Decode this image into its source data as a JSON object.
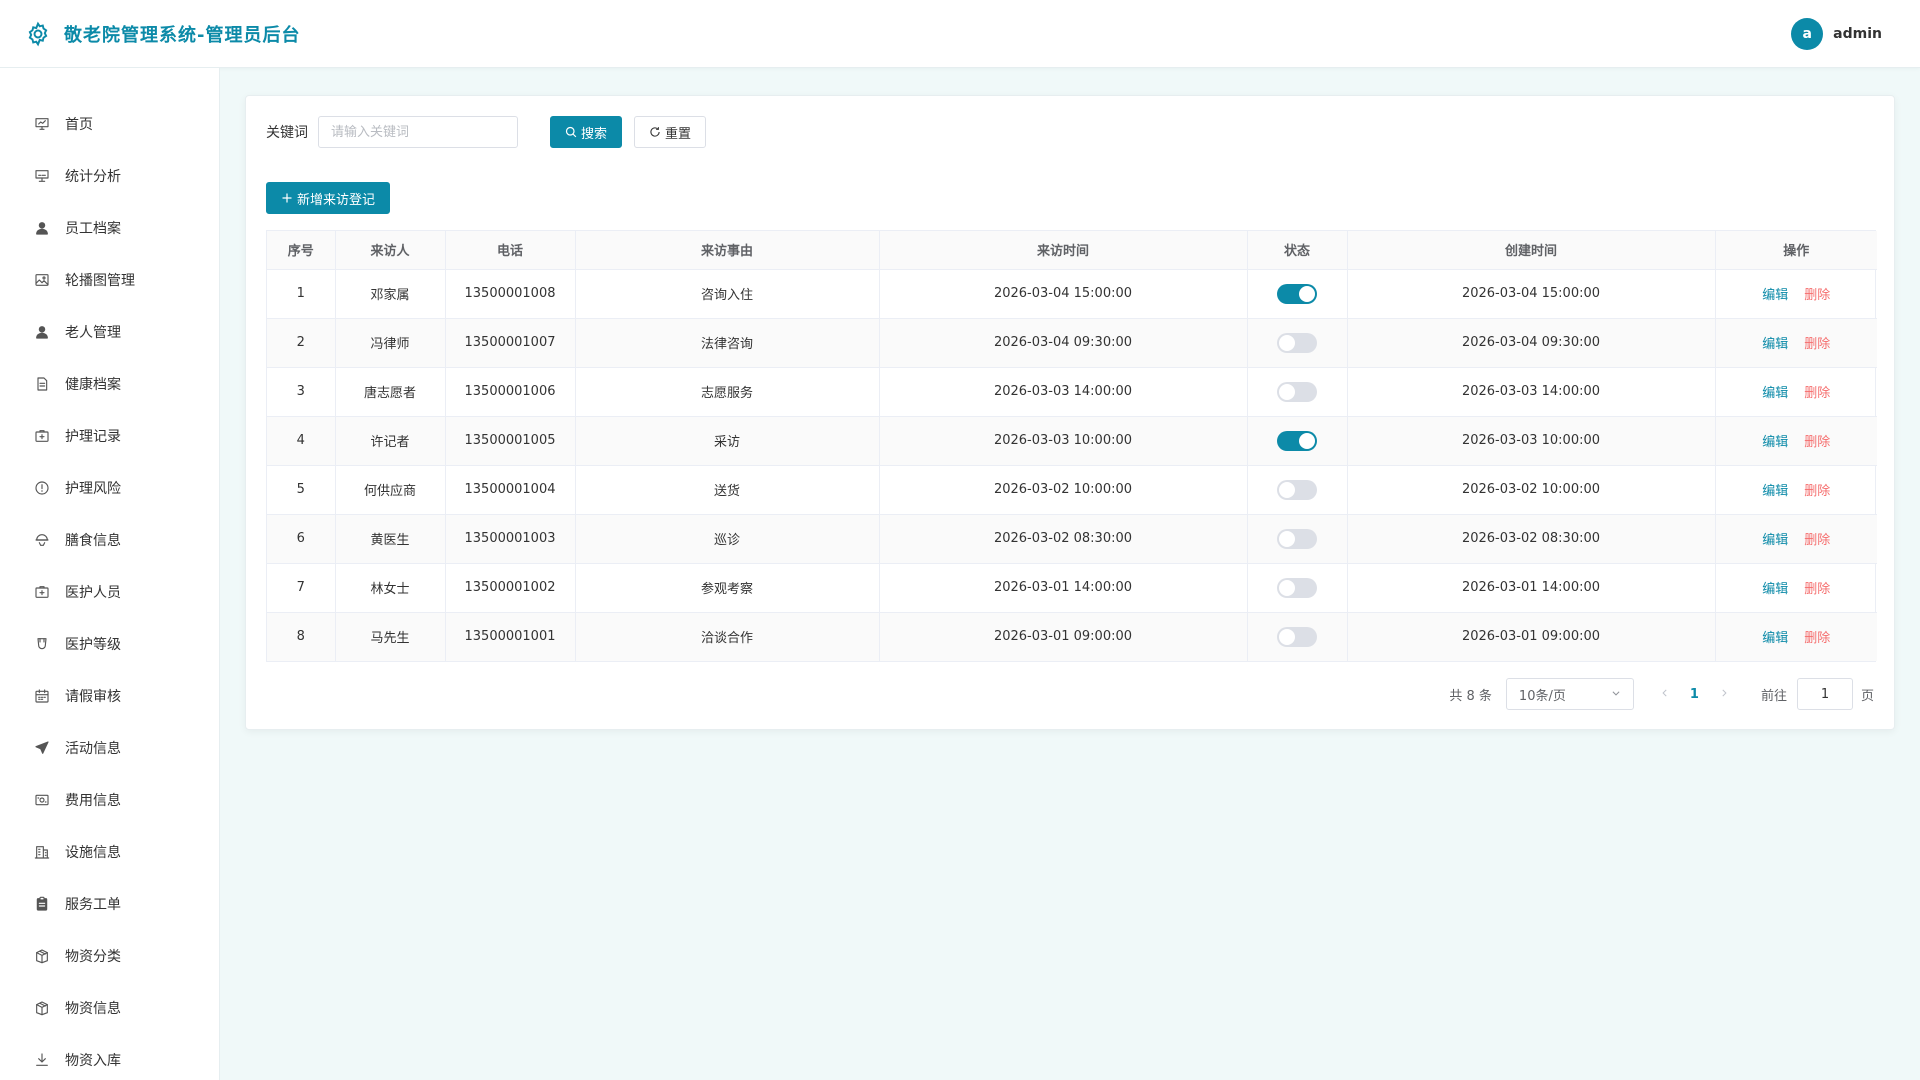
{
  "header": {
    "title": "敬老院管理系统-管理员后台",
    "avatar_letter": "a",
    "username": "admin"
  },
  "sidebar": {
    "items": [
      {
        "label": "首页",
        "icon": "dashboard-icon"
      },
      {
        "label": "统计分析",
        "icon": "presentation-icon"
      },
      {
        "label": "员工档案",
        "icon": "user-icon"
      },
      {
        "label": "轮播图管理",
        "icon": "picture-icon"
      },
      {
        "label": "老人管理",
        "icon": "user-icon"
      },
      {
        "label": "健康档案",
        "icon": "document-icon"
      },
      {
        "label": "护理记录",
        "icon": "first-aid-icon"
      },
      {
        "label": "护理风险",
        "icon": "warning-icon"
      },
      {
        "label": "膳食信息",
        "icon": "food-icon"
      },
      {
        "label": "医护人员",
        "icon": "first-aid-icon"
      },
      {
        "label": "医护等级",
        "icon": "cup-icon"
      },
      {
        "label": "请假审核",
        "icon": "calendar-icon"
      },
      {
        "label": "活动信息",
        "icon": "send-icon"
      },
      {
        "label": "费用信息",
        "icon": "money-icon"
      },
      {
        "label": "设施信息",
        "icon": "building-icon"
      },
      {
        "label": "服务工单",
        "icon": "clipboard-icon"
      },
      {
        "label": "物资分类",
        "icon": "box-icon"
      },
      {
        "label": "物资信息",
        "icon": "box-icon"
      },
      {
        "label": "物资入库",
        "icon": "download-icon"
      }
    ]
  },
  "search": {
    "label": "关键词",
    "placeholder": "请输入关键词",
    "search_btn": "搜索",
    "reset_btn": "重置"
  },
  "toolbar": {
    "add_btn": "新增来访登记"
  },
  "table": {
    "columns": [
      "序号",
      "来访人",
      "电话",
      "来访事由",
      "来访时间",
      "状态",
      "创建时间",
      "操作"
    ],
    "edit_label": "编辑",
    "delete_label": "删除",
    "rows": [
      {
        "index": "1",
        "visitor": "邓家属",
        "phone": "13500001008",
        "reason": "咨询入住",
        "visit_time": "2026-03-04 15:00:00",
        "status": true,
        "created": "2026-03-04 15:00:00"
      },
      {
        "index": "2",
        "visitor": "冯律师",
        "phone": "13500001007",
        "reason": "法律咨询",
        "visit_time": "2026-03-04 09:30:00",
        "status": false,
        "created": "2026-03-04 09:30:00"
      },
      {
        "index": "3",
        "visitor": "唐志愿者",
        "phone": "13500001006",
        "reason": "志愿服务",
        "visit_time": "2026-03-03 14:00:00",
        "status": false,
        "created": "2026-03-03 14:00:00"
      },
      {
        "index": "4",
        "visitor": "许记者",
        "phone": "13500001005",
        "reason": "采访",
        "visit_time": "2026-03-03 10:00:00",
        "status": true,
        "created": "2026-03-03 10:00:00"
      },
      {
        "index": "5",
        "visitor": "何供应商",
        "phone": "13500001004",
        "reason": "送货",
        "visit_time": "2026-03-02 10:00:00",
        "status": false,
        "created": "2026-03-02 10:00:00"
      },
      {
        "index": "6",
        "visitor": "黄医生",
        "phone": "13500001003",
        "reason": "巡诊",
        "visit_time": "2026-03-02 08:30:00",
        "status": false,
        "created": "2026-03-02 08:30:00"
      },
      {
        "index": "7",
        "visitor": "林女士",
        "phone": "13500001002",
        "reason": "参观考察",
        "visit_time": "2026-03-01 14:00:00",
        "status": false,
        "created": "2026-03-01 14:00:00"
      },
      {
        "index": "8",
        "visitor": "马先生",
        "phone": "13500001001",
        "reason": "洽谈合作",
        "visit_time": "2026-03-01 09:00:00",
        "status": false,
        "created": "2026-03-01 09:00:00"
      }
    ]
  },
  "pagination": {
    "total": "共 8 条",
    "page_size": "10条/页",
    "current": "1",
    "goto_label": "前往",
    "goto_value": "1",
    "goto_unit": "页"
  },
  "colors": {
    "accent": "#0c8aa8",
    "danger": "#f56c6c"
  }
}
